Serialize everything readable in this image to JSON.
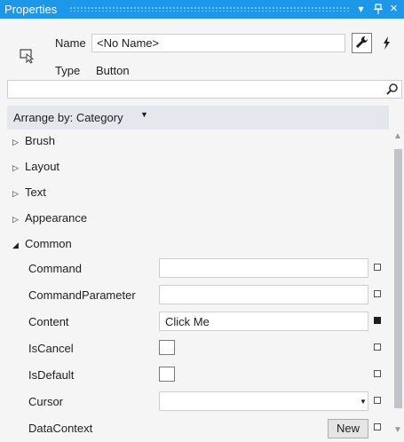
{
  "panel": {
    "title": "Properties",
    "dropdown_icon": "▾",
    "pin_icon": "pin",
    "close_icon": "×"
  },
  "header": {
    "name_label": "Name",
    "name_value": "<No Name>",
    "type_label": "Type",
    "type_value": "Button"
  },
  "search": {
    "value": "",
    "placeholder": ""
  },
  "arrange": {
    "label": "Arrange by: Category"
  },
  "categories": [
    {
      "label": "Brush",
      "expanded": false
    },
    {
      "label": "Layout",
      "expanded": false
    },
    {
      "label": "Text",
      "expanded": false
    },
    {
      "label": "Appearance",
      "expanded": false
    },
    {
      "label": "Common",
      "expanded": true
    }
  ],
  "properties": [
    {
      "label": "Command",
      "editor": "text",
      "value": "",
      "set": false
    },
    {
      "label": "CommandParameter",
      "editor": "text",
      "value": "",
      "set": false
    },
    {
      "label": "Content",
      "editor": "text",
      "value": "Click Me",
      "set": true
    },
    {
      "label": "IsCancel",
      "editor": "checkbox",
      "checked": false,
      "set": false
    },
    {
      "label": "IsDefault",
      "editor": "checkbox",
      "checked": false,
      "set": false
    },
    {
      "label": "Cursor",
      "editor": "dropdown",
      "value": "",
      "set": false
    },
    {
      "label": "DataContext",
      "editor": "button",
      "button_label": "New",
      "set": false
    }
  ],
  "colors": {
    "titlebar": "#1c97ea",
    "panel_bg": "#f5f5f5",
    "arrange_bg": "#e6e7ed"
  }
}
